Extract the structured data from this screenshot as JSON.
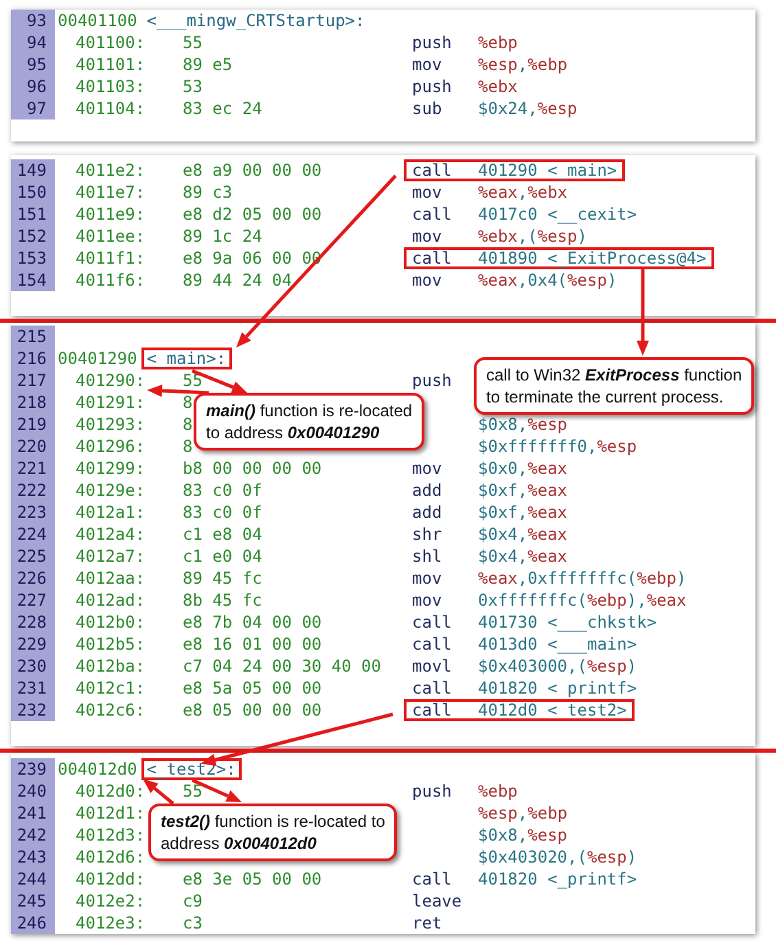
{
  "snippets": [
    {
      "rows": [
        {
          "kind": "label",
          "number": "93",
          "address": "00401100",
          "symbol": "<___mingw_CRTStartup>:",
          "highlighted": false
        },
        {
          "kind": "code",
          "number": "94",
          "address": "401100:",
          "bytes": "55",
          "mnemonic": "push",
          "operands": "%ebp",
          "highlighted": false
        },
        {
          "kind": "code",
          "number": "95",
          "address": "401101:",
          "bytes": "89 e5",
          "mnemonic": "mov",
          "operands": "%esp,%ebp",
          "highlighted": false
        },
        {
          "kind": "code",
          "number": "96",
          "address": "401103:",
          "bytes": "53",
          "mnemonic": "push",
          "operands": "%ebx",
          "highlighted": false
        },
        {
          "kind": "code",
          "number": "97",
          "address": "401104:",
          "bytes": "83 ec 24",
          "mnemonic": "sub",
          "operands": "$0x24,%esp",
          "highlighted": false
        }
      ]
    },
    {
      "rows": [
        {
          "kind": "code",
          "number": "149",
          "address": "4011e2:",
          "bytes": "e8 a9 00 00 00",
          "mnemonic": "call",
          "operands": "401290 <_main>",
          "highlighted": true
        },
        {
          "kind": "code",
          "number": "150",
          "address": "4011e7:",
          "bytes": "89 c3",
          "mnemonic": "mov",
          "operands": "%eax,%ebx",
          "highlighted": false
        },
        {
          "kind": "code",
          "number": "151",
          "address": "4011e9:",
          "bytes": "e8 d2 05 00 00",
          "mnemonic": "call",
          "operands": "4017c0 <__cexit>",
          "highlighted": false
        },
        {
          "kind": "code",
          "number": "152",
          "address": "4011ee:",
          "bytes": "89 1c 24",
          "mnemonic": "mov",
          "operands": "%ebx,(%esp)",
          "highlighted": false
        },
        {
          "kind": "code",
          "number": "153",
          "address": "4011f1:",
          "bytes": "e8 9a 06 00 00",
          "mnemonic": "call",
          "operands": "401890 <_ExitProcess@4>",
          "highlighted": true
        },
        {
          "kind": "code",
          "number": "154",
          "address": "4011f6:",
          "bytes": "89 44 24 04",
          "mnemonic": "mov",
          "operands": "%eax,0x4(%esp)",
          "highlighted": false
        }
      ]
    },
    {
      "rows": [
        {
          "kind": "blank",
          "number": "215"
        },
        {
          "kind": "label",
          "number": "216",
          "address": "00401290",
          "symbol": "<_main>:",
          "highlighted": true
        },
        {
          "kind": "code",
          "number": "217",
          "address": "401290:",
          "bytes": "55",
          "mnemonic": "push",
          "highlighted": false
        },
        {
          "kind": "code",
          "number": "218",
          "address": "401291:",
          "bytes": "8",
          "highlighted": false
        },
        {
          "kind": "code",
          "number": "219",
          "address": "401293:",
          "bytes": "8",
          "operands": "$0x8,%esp",
          "highlighted": false
        },
        {
          "kind": "code",
          "number": "220",
          "address": "401296:",
          "bytes": "8",
          "operands": "$0xfffffff0,%esp",
          "highlighted": false
        },
        {
          "kind": "code",
          "number": "221",
          "address": "401299:",
          "bytes": "b8 00 00 00 00",
          "mnemonic": "mov",
          "operands": "$0x0,%eax",
          "highlighted": false
        },
        {
          "kind": "code",
          "number": "222",
          "address": "40129e:",
          "bytes": "83 c0 0f",
          "mnemonic": "add",
          "operands": "$0xf,%eax",
          "highlighted": false
        },
        {
          "kind": "code",
          "number": "223",
          "address": "4012a1:",
          "bytes": "83 c0 0f",
          "mnemonic": "add",
          "operands": "$0xf,%eax",
          "highlighted": false
        },
        {
          "kind": "code",
          "number": "224",
          "address": "4012a4:",
          "bytes": "c1 e8 04",
          "mnemonic": "shr",
          "operands": "$0x4,%eax",
          "highlighted": false
        },
        {
          "kind": "code",
          "number": "225",
          "address": "4012a7:",
          "bytes": "c1 e0 04",
          "mnemonic": "shl",
          "operands": "$0x4,%eax",
          "highlighted": false
        },
        {
          "kind": "code",
          "number": "226",
          "address": "4012aa:",
          "bytes": "89 45 fc",
          "mnemonic": "mov",
          "operands": "%eax,0xfffffffc(%ebp)",
          "highlighted": false
        },
        {
          "kind": "code",
          "number": "227",
          "address": "4012ad:",
          "bytes": "8b 45 fc",
          "mnemonic": "mov",
          "operands": "0xfffffffc(%ebp),%eax",
          "highlighted": false
        },
        {
          "kind": "code",
          "number": "228",
          "address": "4012b0:",
          "bytes": "e8 7b 04 00 00",
          "mnemonic": "call",
          "operands": "401730 <___chkstk>",
          "highlighted": false
        },
        {
          "kind": "code",
          "number": "229",
          "address": "4012b5:",
          "bytes": "e8 16 01 00 00",
          "mnemonic": "call",
          "operands": "4013d0 <___main>",
          "highlighted": false
        },
        {
          "kind": "code",
          "number": "230",
          "address": "4012ba:",
          "bytes": "c7 04 24 00 30 40 00",
          "mnemonic": "movl",
          "operands": "$0x403000,(%esp)",
          "highlighted": false
        },
        {
          "kind": "code",
          "number": "231",
          "address": "4012c1:",
          "bytes": "e8 5a 05 00 00",
          "mnemonic": "call",
          "operands": "401820 < printf>",
          "highlighted": false
        },
        {
          "kind": "code",
          "number": "232",
          "address": "4012c6:",
          "bytes": "e8 05 00 00 00",
          "mnemonic": "call",
          "operands": "4012d0 < test2>",
          "highlighted": true
        }
      ]
    },
    {
      "rows": [
        {
          "kind": "label",
          "number": "239",
          "address": "004012d0",
          "symbol": "<_test2>:",
          "highlighted": true
        },
        {
          "kind": "code",
          "number": "240",
          "address": "4012d0:",
          "bytes": "55",
          "mnemonic": "push",
          "operands": "%ebp",
          "highlighted": false
        },
        {
          "kind": "code",
          "number": "241",
          "address": "4012d1:",
          "operands": "%esp,%ebp",
          "highlighted": false
        },
        {
          "kind": "code",
          "number": "242",
          "address": "4012d3:",
          "operands": "$0x8,%esp",
          "highlighted": false
        },
        {
          "kind": "code",
          "number": "243",
          "address": "4012d6:",
          "operands": "$0x403020,(%esp)",
          "highlighted": false
        },
        {
          "kind": "code",
          "number": "244",
          "address": "4012dd:",
          "bytes": "e8 3e 05 00 00",
          "mnemonic": "call",
          "operands": "401820 <_printf>",
          "highlighted": false
        },
        {
          "kind": "code",
          "number": "245",
          "address": "4012e2:",
          "bytes": "c9",
          "mnemonic": "leave",
          "highlighted": false
        },
        {
          "kind": "code",
          "number": "246",
          "address": "4012e3:",
          "bytes": "c3",
          "mnemonic": "ret",
          "highlighted": false
        }
      ]
    }
  ],
  "callouts": [
    {
      "lines": [
        "call to Win32 **ExitProcess** function",
        "to terminate the current process."
      ]
    },
    {
      "lines": [
        "**main()** function is re-located",
        "to address **0x00401290**"
      ]
    },
    {
      "lines": [
        "**test2()** function is re-located to",
        "address **0x004012d0**"
      ]
    }
  ]
}
